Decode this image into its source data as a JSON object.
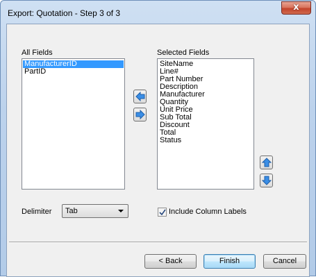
{
  "window": {
    "title": "Export: Quotation - Step 3 of 3",
    "close_glyph": "x"
  },
  "all_fields": {
    "label": "All Fields",
    "items": [
      "ManufacturerID",
      "PartID"
    ],
    "selected_index": 0
  },
  "selected_fields": {
    "label": "Selected Fields",
    "items": [
      "SiteName",
      "Line#",
      "Part Number",
      "Description",
      "Manufacturer",
      "Quantity",
      "Unit Price",
      "Sub Total",
      "Discount",
      "Total",
      "Status"
    ]
  },
  "delimiter": {
    "label": "Delimiter",
    "value": "Tab"
  },
  "include_labels": {
    "label": "Include Column Labels",
    "checked": true
  },
  "buttons": {
    "back": "< Back",
    "finish": "Finish",
    "cancel": "Cancel"
  },
  "colors": {
    "arrow_fill": "#3a8ee6",
    "selection": "#3399ff"
  },
  "icons": {
    "remove": "arrow-left-icon",
    "add": "arrow-right-icon",
    "up": "arrow-up-icon",
    "down": "arrow-down-icon"
  }
}
